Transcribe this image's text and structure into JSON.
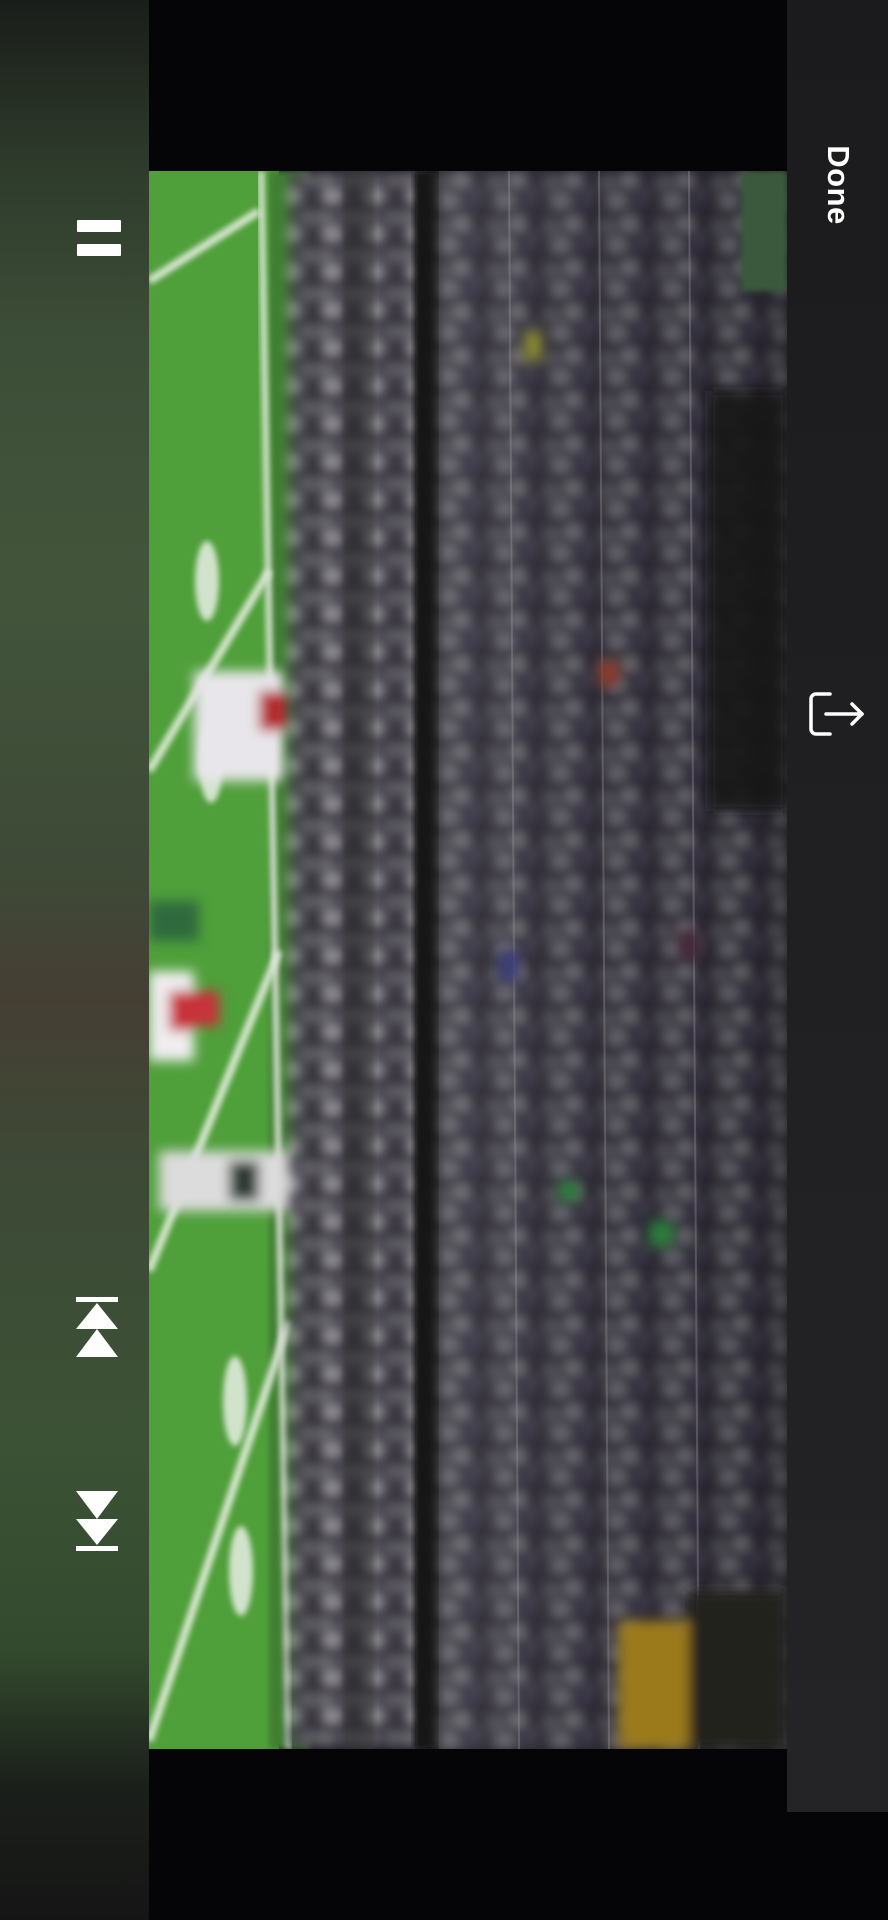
{
  "player": {
    "done_label": "Done",
    "controls": {
      "pause_icon": "pause-icon",
      "skip_back_icon": "skip-back-icon",
      "skip_forward_icon": "skip-forward-icon",
      "share_icon": "share-icon"
    },
    "colors": {
      "control_fg": "#ffffff",
      "field_green": "#4f9f3a",
      "background": "#050508"
    }
  }
}
